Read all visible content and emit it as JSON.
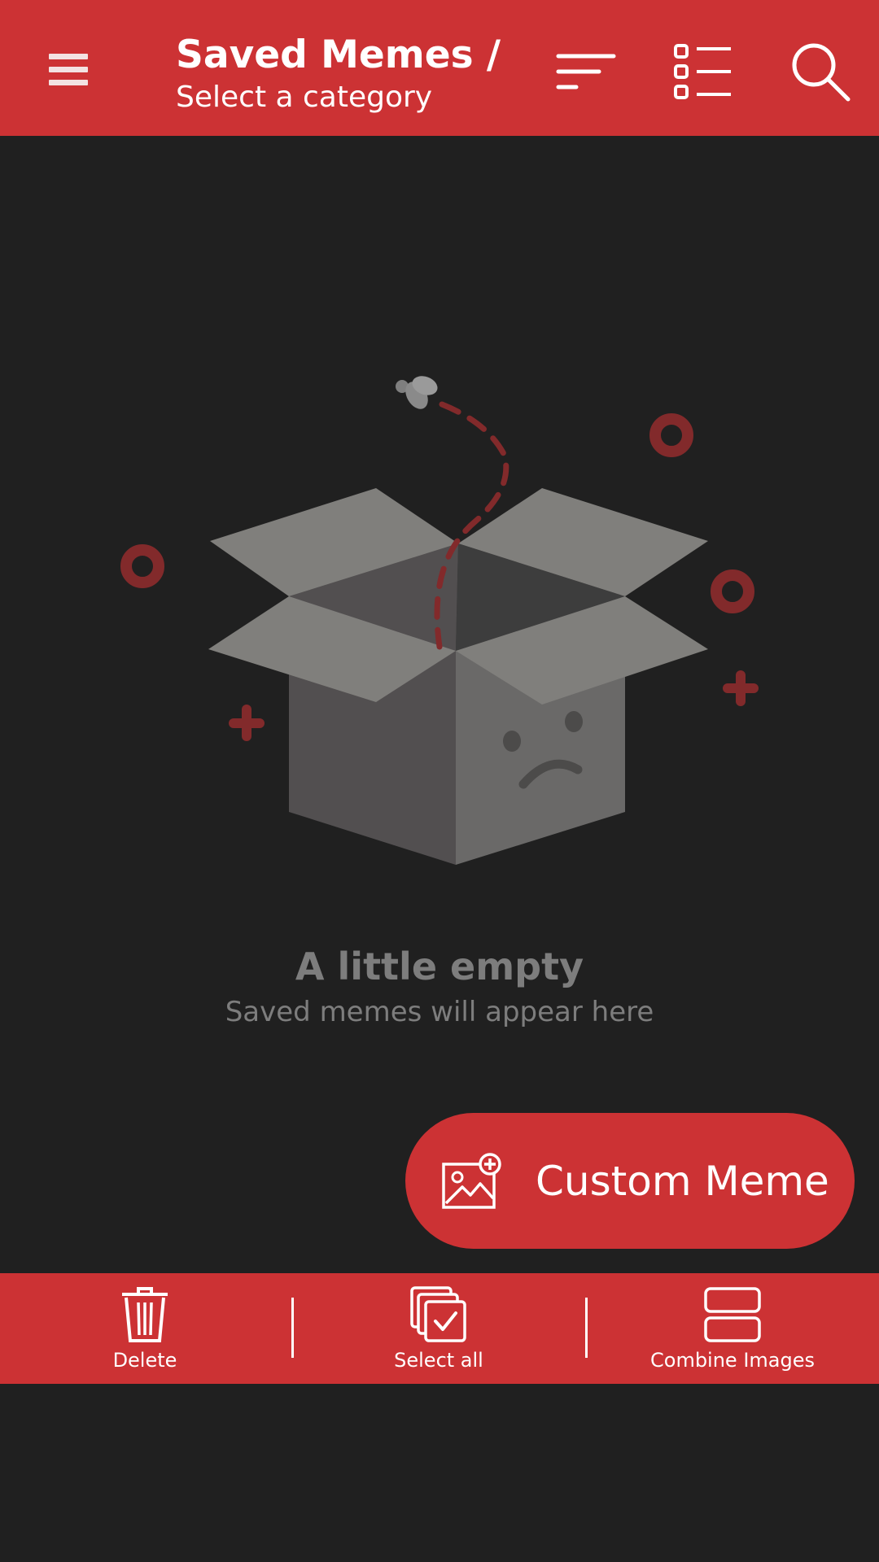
{
  "topbar": {
    "title": "Saved Memes / ...",
    "subtitle": "Select a category",
    "icons": [
      "menu-icon",
      "sort-icon",
      "view-list-icon",
      "search-icon"
    ]
  },
  "empty_state": {
    "title": "A little empty",
    "subtitle": "Saved memes will appear here"
  },
  "fab": {
    "label": "Custom Meme",
    "icon": "add-image-icon"
  },
  "bottombar": {
    "delete_label": "Delete",
    "select_all_label": "Select all",
    "combine_label": "Combine Images"
  },
  "colors": {
    "accent": "#cc3234",
    "background": "#202020",
    "muted_text": "#7d7d7d"
  }
}
